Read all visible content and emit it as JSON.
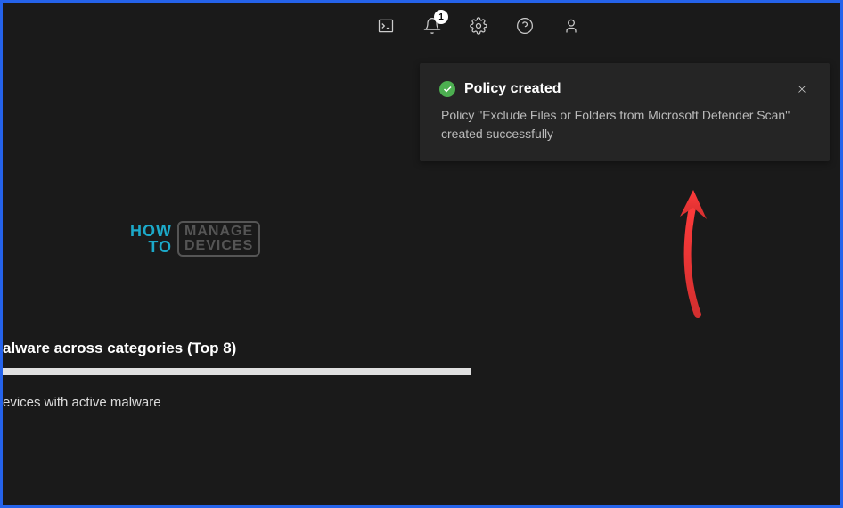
{
  "topbar": {
    "notification_count": "1"
  },
  "toast": {
    "title": "Policy created",
    "message": "Policy \"Exclude Files or Folders from Microsoft Defender Scan\" created successfully"
  },
  "watermark": {
    "how": "HOW",
    "to": "TO",
    "manage": "MANAGE",
    "devices": "DEVICES"
  },
  "section": {
    "title": "alware across categories (Top 8)",
    "subtitle": "evices with active malware"
  }
}
